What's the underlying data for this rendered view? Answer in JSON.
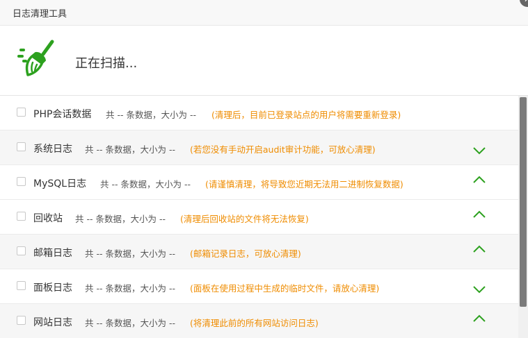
{
  "window": {
    "title": "日志清理工具",
    "close_label": "✕"
  },
  "header": {
    "status_text": "正在扫描...",
    "icon": "broom-icon",
    "icon_color": "#2da11f"
  },
  "accent_color": "#ef8c00",
  "rows": [
    {
      "name": "PHP会话数据",
      "stats": "共 -- 条数据，大小为 --",
      "note": "(清理后，目前已登录站点的用户将需要重新登录)",
      "chevron": "none"
    },
    {
      "name": "系统日志",
      "stats": "共 -- 条数据，大小为 --",
      "note": "(若您没有手动开启audit审计功能，可放心清理)",
      "chevron": "down"
    },
    {
      "name": "MySQL日志",
      "stats": "共 -- 条数据，大小为 --",
      "note": "(请谨慎清理，将导致您近期无法用二进制恢复数据)",
      "chevron": "up"
    },
    {
      "name": "回收站",
      "stats": "共 -- 条数据，大小为 --",
      "note": "(清理后回收站的文件将无法恢复)",
      "chevron": "up"
    },
    {
      "name": "邮箱日志",
      "stats": "共 -- 条数据，大小为 --",
      "note": "(邮箱记录日志，可放心清理)",
      "chevron": "up"
    },
    {
      "name": "面板日志",
      "stats": "共 -- 条数据，大小为 --",
      "note": "(面板在使用过程中生成的临时文件，请放心清理)",
      "chevron": "down"
    },
    {
      "name": "网站日志",
      "stats": "共 -- 条数据，大小为 --",
      "note": "(将清理此前的所有网站访问日志)",
      "chevron": "up"
    }
  ]
}
